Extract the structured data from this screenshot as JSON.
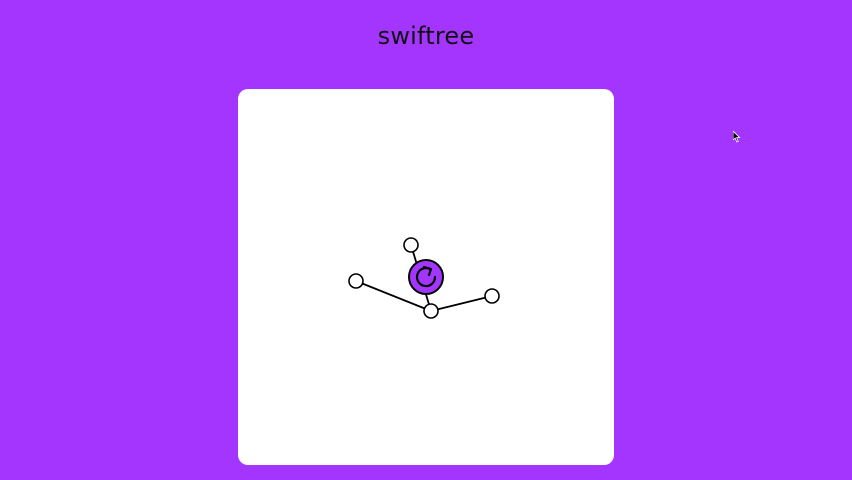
{
  "app": {
    "title": "swiftree"
  },
  "board": {
    "accent_color": "#a435ff",
    "background_color": "#ffffff",
    "edge_color": "#000000",
    "node_fill": "#ffffff",
    "center_button_icon": "refresh-icon"
  },
  "tree": {
    "nodes": [
      {
        "id": "hub"
      },
      {
        "id": "top"
      },
      {
        "id": "left"
      },
      {
        "id": "right"
      }
    ],
    "edges": [
      {
        "from": "hub",
        "to": "top"
      },
      {
        "from": "hub",
        "to": "left"
      },
      {
        "from": "hub",
        "to": "right"
      }
    ]
  },
  "cursor": {
    "icon": "mouse-pointer-icon"
  }
}
